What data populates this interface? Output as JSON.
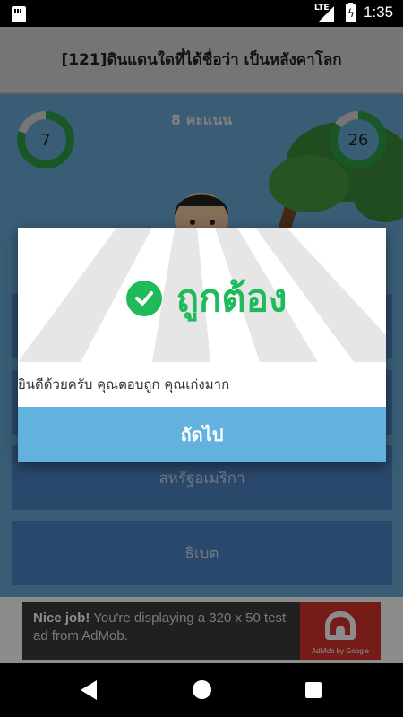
{
  "status_bar": {
    "network": "LTE",
    "time": "1:35"
  },
  "header": {
    "title": "[121]ดินแดนใดที่ได้ชื่อว่า เป็นหลังคาโลก"
  },
  "game": {
    "score_label": "8 คะแนน",
    "left_counter": "7",
    "right_counter": "26"
  },
  "options": [
    {
      "label": ""
    },
    {
      "label": ""
    },
    {
      "label": "สหรัฐอเมริกา"
    },
    {
      "label": "ธิเบต"
    }
  ],
  "dialog": {
    "result_text": "ถูกต้อง",
    "message": "ยินดีด้วยครับ คุณตอบถูก คุณเก่งมาก",
    "next_button": "ถัดไป"
  },
  "ad": {
    "headline": "Nice job!",
    "body": " You're displaying a 320 x 50 test ad from AdMob.",
    "logo_text": "AdMob by Google"
  },
  "colors": {
    "correct_green": "#1fba5a",
    "next_button_blue": "#63b1df",
    "option_blue": "#4d83c4",
    "background_sky": "#6aaad7"
  }
}
